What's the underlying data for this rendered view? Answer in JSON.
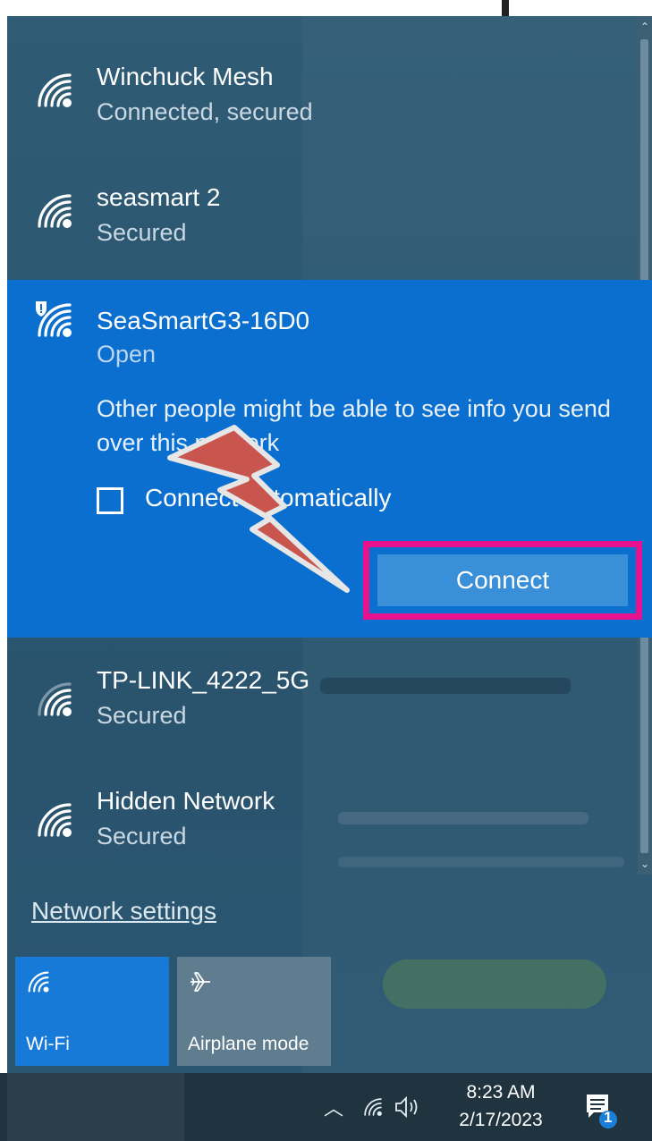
{
  "networks": [
    {
      "name": "Winchuck Mesh",
      "status": "Connected, secured"
    },
    {
      "name": "seasmart 2",
      "status": "Secured"
    },
    {
      "name": "SeaSmartG3-16D0",
      "status": "Open"
    },
    {
      "name": "TP-LINK_4222_5G",
      "status": "Secured"
    },
    {
      "name": "Hidden Network",
      "status": "Secured"
    }
  ],
  "expanded": {
    "warning": "Other people might be able to see info you send over this network",
    "auto_connect_label": "Connect automatically",
    "auto_connect_checked": false,
    "connect_label": "Connect"
  },
  "network_settings_link": "Network settings",
  "quick_actions": [
    {
      "label": "Wi-Fi",
      "icon": "wifi-icon",
      "active": true
    },
    {
      "label": "Airplane mode",
      "icon": "airplane-icon",
      "active": false
    }
  ],
  "taskbar": {
    "time": "8:23 AM",
    "date": "2/17/2023",
    "notification_count": "1"
  },
  "colors": {
    "flyout_bg": "#2b5670",
    "selected_bg": "#0a6fcf",
    "highlight_frame": "#e8128f",
    "arrow_fill": "#c8554e"
  }
}
